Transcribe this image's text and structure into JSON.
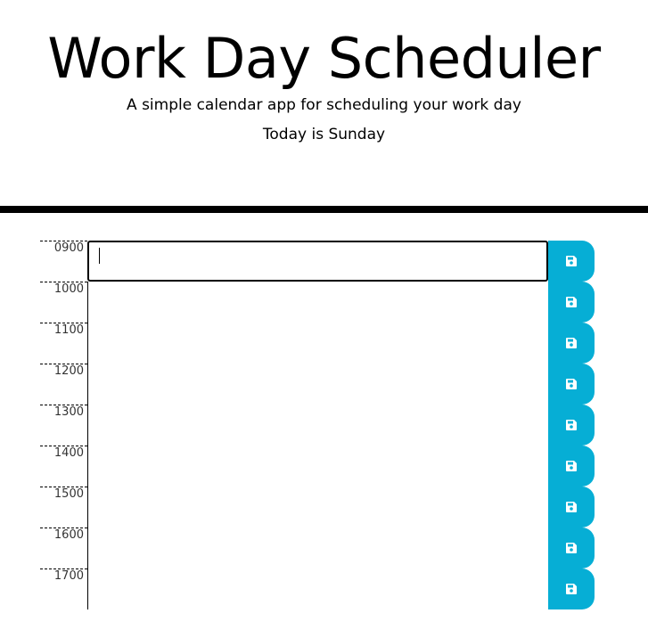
{
  "header": {
    "title": "Work Day Scheduler",
    "subtitle": "A simple calendar app for scheduling your work day",
    "current_day": "Today is Sunday"
  },
  "colors": {
    "save_button": "#06aed5",
    "divider": "#000000"
  },
  "schedule": {
    "rows": [
      {
        "hour": "0900",
        "text": "",
        "save_icon": "save-icon"
      },
      {
        "hour": "1000",
        "text": "",
        "save_icon": "save-icon"
      },
      {
        "hour": "1100",
        "text": "",
        "save_icon": "save-icon"
      },
      {
        "hour": "1200",
        "text": "",
        "save_icon": "save-icon"
      },
      {
        "hour": "1300",
        "text": "",
        "save_icon": "save-icon"
      },
      {
        "hour": "1400",
        "text": "",
        "save_icon": "save-icon"
      },
      {
        "hour": "1500",
        "text": "",
        "save_icon": "save-icon"
      },
      {
        "hour": "1600",
        "text": "",
        "save_icon": "save-icon"
      },
      {
        "hour": "1700",
        "text": "",
        "save_icon": "save-icon"
      }
    ]
  }
}
